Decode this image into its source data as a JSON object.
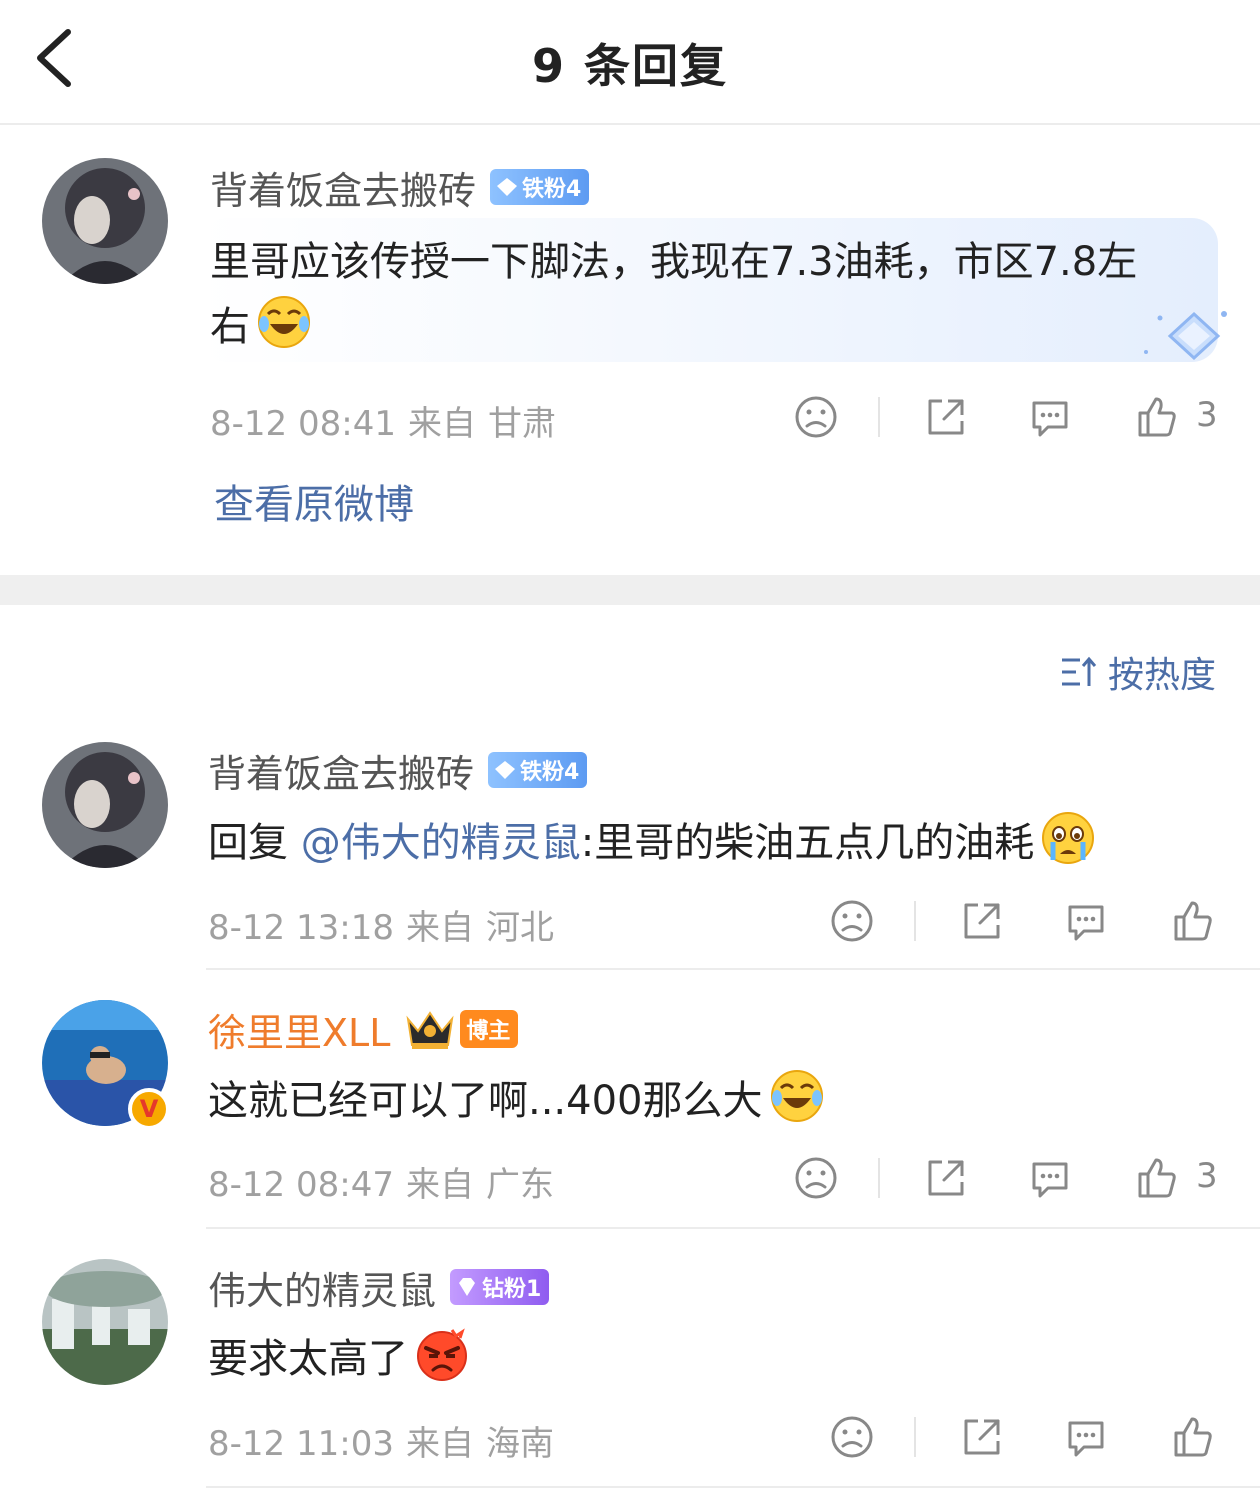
{
  "header": {
    "title": "9 条回复"
  },
  "main_comment": {
    "username": "背着饭盒去搬砖",
    "badge": "铁粉4",
    "text": "里哥应该传授一下脚法，我现在7.3油耗，市区7.8左右",
    "time": "8-12 08:41",
    "from": "来自",
    "location": "甘肃",
    "likes": "3",
    "view_original": "查看原微博"
  },
  "sort": {
    "label": "按热度"
  },
  "replies": [
    {
      "username": "背着饭盒去搬砖",
      "badge": "铁粉4",
      "reply_prefix": "回复",
      "mention": "@伟大的精灵鼠",
      "text": ":里哥的柴油五点几的油耗",
      "time": "8-12 13:18",
      "from": "来自",
      "location": "河北",
      "likes": ""
    },
    {
      "username": "徐里里XLL",
      "badge": "博主",
      "text": "这就已经可以了啊...400那么大",
      "time": "8-12 08:47",
      "from": "来自",
      "location": "广东",
      "likes": "3"
    },
    {
      "username": "伟大的精灵鼠",
      "badge": "钻粉1",
      "text": "要求太高了",
      "time": "8-12 11:03",
      "from": "来自",
      "location": "海南",
      "likes": ""
    }
  ],
  "colors": {
    "link": "#4c6ea7",
    "meta": "#a0a0a0",
    "blogger_name": "#ef7c2c",
    "badge_iron": "#5d9bf2",
    "badge_diamond": "#8f5cf0",
    "badge_blogger": "#ff8a1e"
  },
  "icons": {
    "back": "chevron-left-icon",
    "dislike": "frown-face-icon",
    "share": "share-icon",
    "comment": "comment-bubble-icon",
    "like": "thumbs-up-icon",
    "sort": "sort-icon"
  }
}
